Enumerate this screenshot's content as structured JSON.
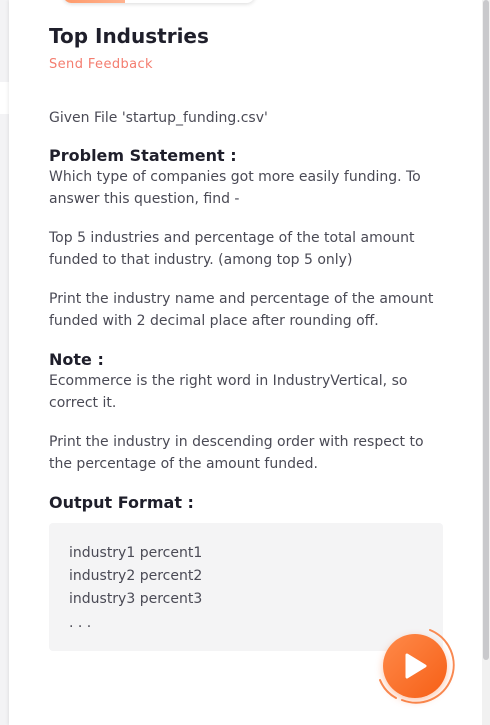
{
  "problem": {
    "title": "Top Industries",
    "feedback_link": "Send Feedback",
    "given_file": "Given File 'startup_funding.csv'",
    "problem_statement_heading": "Problem Statement :",
    "problem_statement_line1": "Which type of companies got more easily funding. To",
    "problem_statement_line2": "answer this question, find -",
    "task_line1": "Top 5 industries and percentage of the total amount",
    "task_line2": "funded to that industry. (among top 5 only)",
    "print_line1": "Print the industry name and percentage of the amount",
    "print_line2": "funded with 2 decimal place after rounding off.",
    "note_heading": "Note :",
    "note_line1": "Ecommerce is the right word in IndustryVertical, so",
    "note_line2": "correct it.",
    "order_line1": "Print the industry in descending order with respect to",
    "order_line2": "the percentage of the amount funded.",
    "output_format_heading": "Output Format :",
    "output_lines": [
      "industry1 percent1",
      "industry2 percent2",
      "industry3 percent3",
      ". . ."
    ]
  },
  "colors": {
    "accent": "#f65f16",
    "feedback": "#f47d6f"
  },
  "icons": {
    "run": "play-icon"
  }
}
